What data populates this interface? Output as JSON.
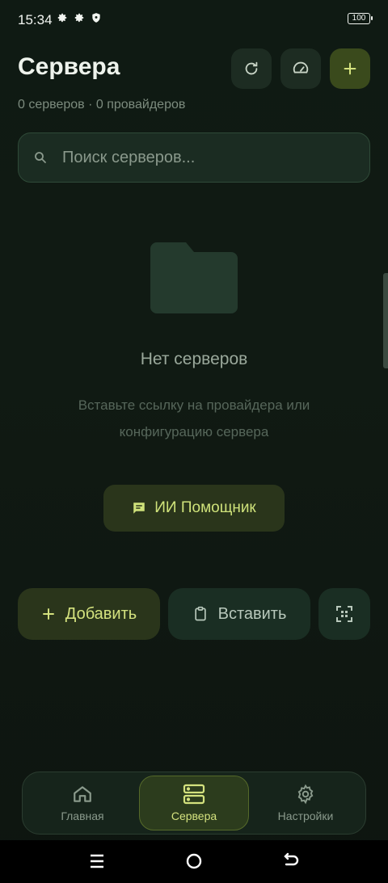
{
  "status": {
    "time": "15:34",
    "battery": "100"
  },
  "header": {
    "title": "Сервера",
    "subtitle": "0 серверов · 0 провайдеров"
  },
  "search": {
    "placeholder": "Поиск серверов..."
  },
  "empty": {
    "title": "Нет серверов",
    "description": "Вставьте ссылку на провайдера или конфигурацию сервера"
  },
  "actions": {
    "ai_label": "ИИ Помощник",
    "add_label": "Добавить",
    "paste_label": "Вставить"
  },
  "nav": {
    "items": [
      {
        "label": "Главная",
        "icon": "home-icon"
      },
      {
        "label": "Сервера",
        "icon": "servers-icon"
      },
      {
        "label": "Настройки",
        "icon": "gear-icon"
      }
    ],
    "active_index": 1
  },
  "colors": {
    "accent": "#d4e27e",
    "background": "#0f1a13",
    "surface": "#1b2c22"
  }
}
